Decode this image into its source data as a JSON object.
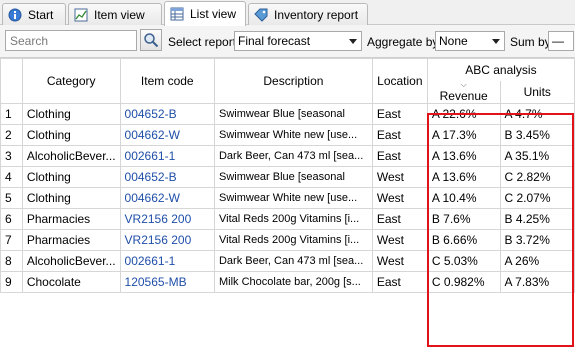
{
  "tabs": [
    {
      "label": "Start",
      "icon": "info-icon"
    },
    {
      "label": "Item view",
      "icon": "chart-icon"
    },
    {
      "label": "List view",
      "icon": "table-icon",
      "active": true
    },
    {
      "label": "Inventory report",
      "icon": "tag-icon"
    }
  ],
  "toolbar": {
    "search_placeholder": "Search",
    "select_report_label": "Select report",
    "select_report_value": "Final forecast",
    "aggregate_by_label": "Aggregate by",
    "aggregate_by_value": "None",
    "sum_by_label": "Sum by",
    "sum_by_value": "—"
  },
  "grid": {
    "columns": {
      "category": "Category",
      "item_code": "Item code",
      "description": "Description",
      "location": "Location",
      "abc_group": "ABC analysis",
      "revenue": "Revenue",
      "units": "Units"
    },
    "rows": [
      {
        "n": "1",
        "category": "Clothing",
        "code": "004652-B",
        "desc": "Swimwear Blue [seasonal",
        "loc": "East",
        "rev": "A 22.6%",
        "units": "A 4.7%"
      },
      {
        "n": "2",
        "category": "Clothing",
        "code": "004662-W",
        "desc": "Swimwear White new [use...",
        "loc": "East",
        "rev": "A 17.3%",
        "units": "B 3.45%"
      },
      {
        "n": "3",
        "category": "AlcoholicBever...",
        "code": "002661-1",
        "desc": "Dark Beer, Can 473 ml [sea...",
        "loc": "East",
        "rev": "A 13.6%",
        "units": "A 35.1%"
      },
      {
        "n": "4",
        "category": "Clothing",
        "code": "004652-B",
        "desc": "Swimwear Blue [seasonal",
        "loc": "West",
        "rev": "A 13.6%",
        "units": "C 2.82%"
      },
      {
        "n": "5",
        "category": "Clothing",
        "code": "004662-W",
        "desc": "Swimwear White new [use...",
        "loc": "West",
        "rev": "A 10.4%",
        "units": "C 2.07%"
      },
      {
        "n": "6",
        "category": "Pharmacies",
        "code": "VR2156 200",
        "desc": "Vital Reds 200g Vitamins [i...",
        "loc": "East",
        "rev": "B 7.6%",
        "units": "B 4.25%"
      },
      {
        "n": "7",
        "category": "Pharmacies",
        "code": "VR2156 200",
        "desc": "Vital Reds 200g Vitamins [i...",
        "loc": "West",
        "rev": "B 6.66%",
        "units": "B 3.72%"
      },
      {
        "n": "8",
        "category": "AlcoholicBever...",
        "code": "002661-1",
        "desc": "Dark Beer, Can 473 ml [sea...",
        "loc": "West",
        "rev": "C 5.03%",
        "units": "A 26%"
      },
      {
        "n": "9",
        "category": "Chocolate",
        "code": "120565-MB",
        "desc": "Milk Chocolate bar, 200g [s...",
        "loc": "East",
        "rev": "C 0.982%",
        "units": "A 7.83%"
      }
    ]
  },
  "colors": {
    "link": "#1f4fa8",
    "highlight": "#e0131a"
  }
}
